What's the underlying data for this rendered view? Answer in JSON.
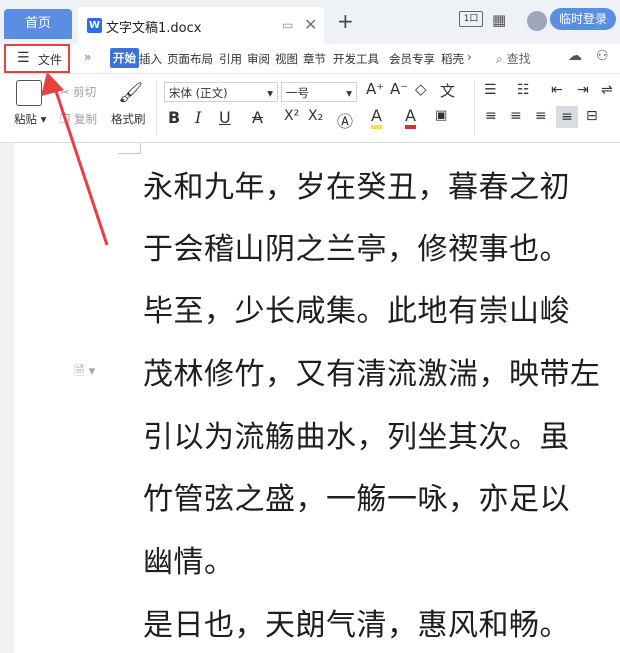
{
  "titlebar": {
    "home_tab": "首页",
    "doc_tab": "文字文稿1.docx",
    "new_tab": "+",
    "layout_icon_text": "1口",
    "login_button": "临时登录"
  },
  "ribbon": {
    "file_menu": "文件",
    "more_left": "»",
    "tabs": [
      "开始",
      "插入",
      "页面布局",
      "引用",
      "审阅",
      "视图",
      "章节",
      "开发工具",
      "会员专享",
      "稻壳"
    ],
    "more_right": "›",
    "search_label": "查找"
  },
  "toolbar": {
    "paste": "粘贴",
    "cut": "剪切",
    "copy": "复制",
    "format_painter": "格式刷",
    "font_name": "宋体 (正文)",
    "font_size": "一号",
    "grow_font": "A⁺",
    "shrink_font": "A⁻",
    "bold": "B",
    "italic": "I",
    "underline": "U",
    "strike": "A",
    "superscript": "X²",
    "subscript": "X₂",
    "highlight": "A",
    "font_color": "A"
  },
  "document": {
    "lines": [
      "永和九年，岁在癸丑，暮春之初",
      "于会稽山阴之兰亭，修禊事也。",
      "毕至，少长咸集。此地有崇山峻",
      "茂林修竹，又有清流激湍，映带左",
      "引以为流觞曲水，列坐其次。虽",
      "竹管弦之盛，一觞一咏，亦足以",
      "幽情。",
      "是日也，天朗气清，惠风和畅。"
    ]
  },
  "colors": {
    "accent": "#5b8de3",
    "highlight_box": "#e84040",
    "active_tab": "#3a73d9"
  }
}
